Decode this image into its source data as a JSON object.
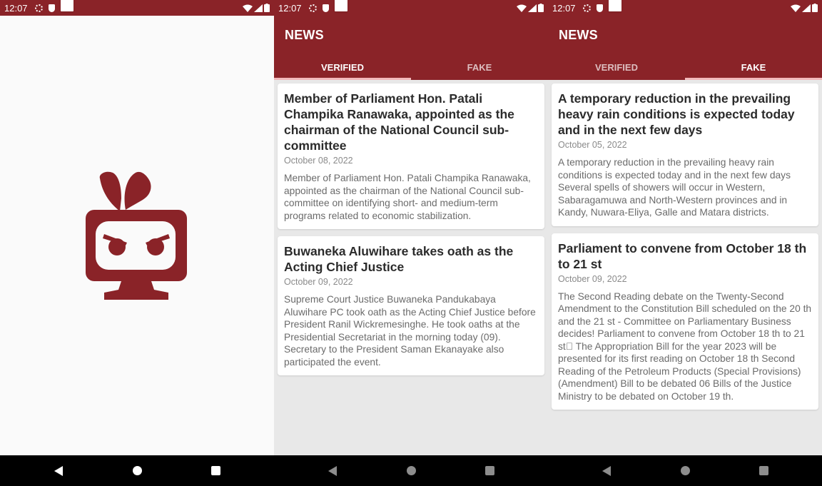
{
  "status_time": "12:07",
  "colors": {
    "brand": "#8a2328",
    "tab_indicator": "#f2b8bb",
    "card": "#ffffff",
    "background": "#e8e8e8"
  },
  "splash": {
    "logo": "angry-tv-logo-icon"
  },
  "app_title": "NEWS",
  "tabs": {
    "verified": "VERIFIED",
    "fake": "FAKE"
  },
  "verified_news": [
    {
      "title": "Member of Parliament Hon. Patali Champika Ranawaka, appointed as the chairman of the National Council sub-committee",
      "date": "October 08, 2022",
      "body": "Member of Parliament Hon. Patali Champika Ranawaka, appointed as the chairman of the National Council sub-committee on identifying short- and medium-term programs related to economic stabilization."
    },
    {
      "title": "Buwaneka Aluwihare takes oath as the Acting Chief Justice",
      "date": "October 09, 2022",
      "body": "Supreme Court Justice Buwaneka Pandukabaya Aluwihare PC took oath as the Acting Chief Justice before President Ranil Wickremesinghe. He took oaths at the Presidential Secretariat in the morning today (09). Secretary to the President Saman Ekanayake also participated the event."
    }
  ],
  "fake_news": [
    {
      "title": "A temporary reduction in the prevailing heavy rain conditions is expected today and in the next few days",
      "date": "October 05, 2022",
      "body": "A temporary reduction in the prevailing heavy rain conditions is expected today and in the next few days Several spells of showers will occur in Western, Sabaragamuwa and North-Western provinces and in Kandy, Nuwara-Eliya, Galle and Matara districts."
    },
    {
      "title": "Parliament to convene from October 18 th to 21 st",
      "date": "October 09, 2022",
      "body": "The Second Reading debate on the Twenty-Second Amendment to the Constitution Bill scheduled on the 20 th and the 21 st - Committee on Parliamentary Business decides! Parliament to convene from October 18 th to 21 st\u0000 The Appropriation Bill for the year 2023 will be presented for its first reading on October 18 th Second Reading of the Petroleum Products (Special Provisions) (Amendment) Bill to be debated 06 Bills of the Justice Ministry to be debated on October 19 th."
    }
  ]
}
